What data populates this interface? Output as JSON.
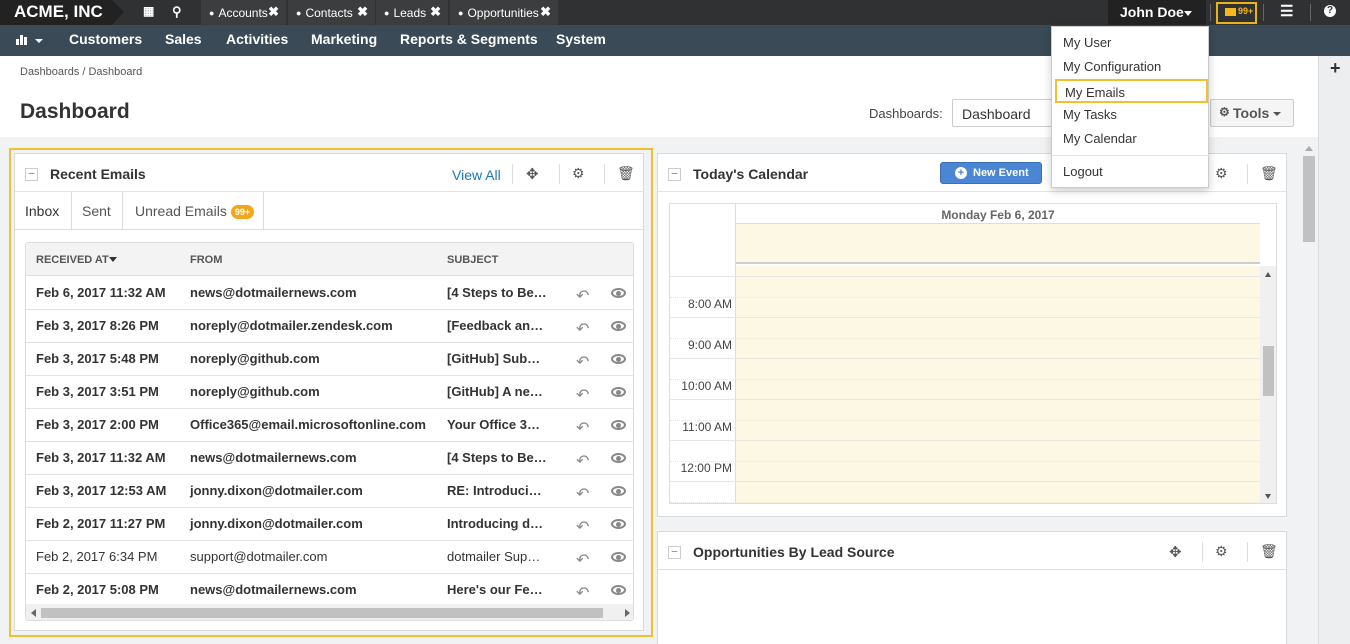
{
  "topbar": {
    "brand": "ACME, INC",
    "tabs": [
      {
        "label": "Accounts"
      },
      {
        "label": "Contacts"
      },
      {
        "label": "Leads"
      },
      {
        "label": "Opportunities"
      }
    ],
    "user_name": "John Doe",
    "mail_count": "99+"
  },
  "nav": {
    "items": [
      "Customers",
      "Sales",
      "Activities",
      "Marketing",
      "Reports & Segments",
      "System"
    ]
  },
  "breadcrumb": "Dashboards / Dashboard",
  "page_title": "Dashboard",
  "toolbar": {
    "dashboards_label": "Dashboards:",
    "dashboard_select": "Dashboard",
    "tools_label": "Tools"
  },
  "user_menu": {
    "items": [
      "My User",
      "My Configuration",
      "My Emails",
      "My Tasks",
      "My Calendar"
    ],
    "logout": "Logout",
    "highlighted": "My Emails"
  },
  "recent_emails": {
    "title": "Recent Emails",
    "view_all": "View All",
    "tabs": [
      "Inbox",
      "Sent",
      "Unread Emails"
    ],
    "unread_badge": "99+",
    "columns": [
      "RECEIVED AT",
      "FROM",
      "SUBJECT"
    ],
    "rows": [
      {
        "received": "Feb 6, 2017 11:32 AM",
        "from": "news@dotmailernews.com",
        "subject": "[4 Steps to Be…",
        "bold": true
      },
      {
        "received": "Feb 3, 2017 8:26 PM",
        "from": "noreply@dotmailer.zendesk.com",
        "subject": "[Feedback an…",
        "bold": true
      },
      {
        "received": "Feb 3, 2017 5:48 PM",
        "from": "noreply@github.com",
        "subject": "[GitHub] Sub…",
        "bold": true
      },
      {
        "received": "Feb 3, 2017 3:51 PM",
        "from": "noreply@github.com",
        "subject": "[GitHub] A ne…",
        "bold": true
      },
      {
        "received": "Feb 3, 2017 2:00 PM",
        "from": "Office365@email.microsoftonline.com",
        "subject": "Your Office 3…",
        "bold": true
      },
      {
        "received": "Feb 3, 2017 11:32 AM",
        "from": "news@dotmailernews.com",
        "subject": "[4 Steps to Be…",
        "bold": true
      },
      {
        "received": "Feb 3, 2017 12:53 AM",
        "from": "jonny.dixon@dotmailer.com",
        "subject": "RE: Introduci…",
        "bold": true
      },
      {
        "received": "Feb 2, 2017 11:27 PM",
        "from": "jonny.dixon@dotmailer.com",
        "subject": "Introducing d…",
        "bold": true
      },
      {
        "received": "Feb 2, 2017 6:34 PM",
        "from": "support@dotmailer.com",
        "subject": "dotmailer Sup…",
        "bold": false
      },
      {
        "received": "Feb 2, 2017 5:08 PM",
        "from": "news@dotmailernews.com",
        "subject": "Here's our Fe…",
        "bold": true
      }
    ]
  },
  "calendar": {
    "title": "Today's Calendar",
    "new_event": "New Event",
    "day_header": "Monday Feb 6, 2017",
    "times": [
      "8:00 AM",
      "9:00 AM",
      "10:00 AM",
      "11:00 AM",
      "12:00 PM"
    ]
  },
  "opportunities": {
    "title": "Opportunities By Lead Source"
  },
  "colors": {
    "topbar": "#2f3132",
    "navbar": "#3a4a56",
    "highlight": "#f0c030",
    "link": "#1f75b9",
    "calendar_bg": "#fcf8e3"
  }
}
